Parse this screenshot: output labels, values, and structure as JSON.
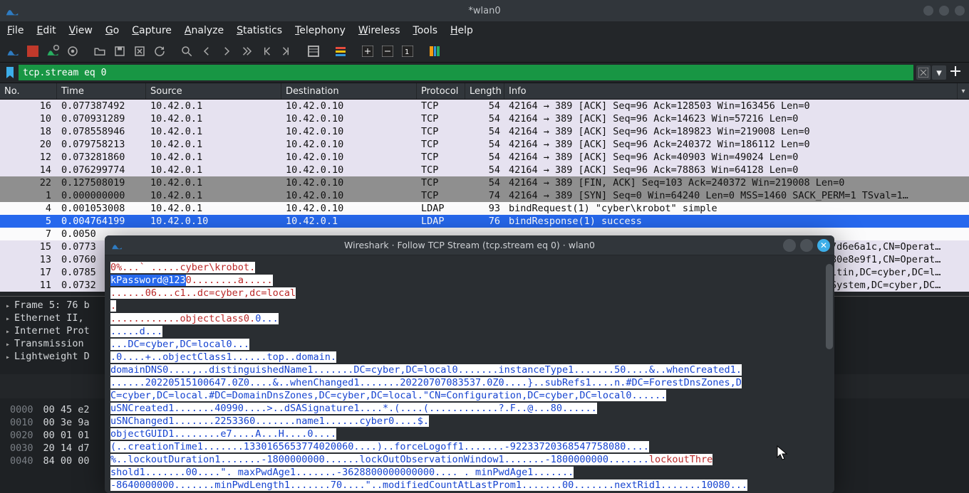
{
  "titlebar": {
    "title": "*wlan0"
  },
  "menubar": [
    "File",
    "Edit",
    "View",
    "Go",
    "Capture",
    "Analyze",
    "Statistics",
    "Telephony",
    "Wireless",
    "Tools",
    "Help"
  ],
  "filter": {
    "value": "tcp.stream eq 0"
  },
  "columns": [
    "No.",
    "Time",
    "Source",
    "Destination",
    "Protocol",
    "Length",
    "Info"
  ],
  "packets": [
    {
      "no": "16",
      "time": "0.077387492",
      "src": "10.42.0.1",
      "dst": "10.42.0.10",
      "proto": "TCP",
      "len": "54",
      "info": "42164 → 389 [ACK] Seq=96 Ack=128503 Win=163456 Len=0",
      "cls": ""
    },
    {
      "no": "10",
      "time": "0.070931289",
      "src": "10.42.0.1",
      "dst": "10.42.0.10",
      "proto": "TCP",
      "len": "54",
      "info": "42164 → 389 [ACK] Seq=96 Ack=14623 Win=57216 Len=0",
      "cls": ""
    },
    {
      "no": "18",
      "time": "0.078558946",
      "src": "10.42.0.1",
      "dst": "10.42.0.10",
      "proto": "TCP",
      "len": "54",
      "info": "42164 → 389 [ACK] Seq=96 Ack=189823 Win=219008 Len=0",
      "cls": ""
    },
    {
      "no": "20",
      "time": "0.079758213",
      "src": "10.42.0.1",
      "dst": "10.42.0.10",
      "proto": "TCP",
      "len": "54",
      "info": "42164 → 389 [ACK] Seq=96 Ack=240372 Win=186112 Len=0",
      "cls": ""
    },
    {
      "no": "12",
      "time": "0.073281860",
      "src": "10.42.0.1",
      "dst": "10.42.0.10",
      "proto": "TCP",
      "len": "54",
      "info": "42164 → 389 [ACK] Seq=96 Ack=40903 Win=49024 Len=0",
      "cls": ""
    },
    {
      "no": "14",
      "time": "0.076299774",
      "src": "10.42.0.1",
      "dst": "10.42.0.10",
      "proto": "TCP",
      "len": "54",
      "info": "42164 → 389 [ACK] Seq=96 Ack=78863 Win=64128 Len=0",
      "cls": ""
    },
    {
      "no": "22",
      "time": "0.127508019",
      "src": "10.42.0.1",
      "dst": "10.42.0.10",
      "proto": "TCP",
      "len": "54",
      "info": "42164 → 389 [FIN, ACK] Seq=103 Ack=240372 Win=219008 Len=0",
      "cls": "gray"
    },
    {
      "no": "1",
      "time": "0.000000000",
      "src": "10.42.0.1",
      "dst": "10.42.0.10",
      "proto": "TCP",
      "len": "74",
      "info": "42164 → 389 [SYN] Seq=0 Win=64240 Len=0 MSS=1460 SACK_PERM=1 TSval=1…",
      "cls": "gray"
    },
    {
      "no": "4",
      "time": "0.001053008",
      "src": "10.42.0.1",
      "dst": "10.42.0.10",
      "proto": "LDAP",
      "len": "93",
      "info": "bindRequest(1) \"cyber\\krobot\" simple",
      "cls": "white"
    },
    {
      "no": "5",
      "time": "0.004764199",
      "src": "10.42.0.10",
      "dst": "10.42.0.1",
      "proto": "LDAP",
      "len": "76",
      "info": "bindResponse(1) success",
      "cls": "sel"
    },
    {
      "no": "7",
      "time": "0.0050",
      "src": "",
      "dst": "",
      "proto": "",
      "len": "",
      "info": "",
      "cls": "white"
    },
    {
      "no": "15",
      "time": "0.0773",
      "src": "",
      "dst": "",
      "proto": "",
      "len": "",
      "info": "7d6e6a1c,CN=Operat…",
      "cls": ""
    },
    {
      "no": "13",
      "time": "0.0760",
      "src": "",
      "dst": "",
      "proto": "",
      "len": "",
      "info": "80e8e9f1,CN=Operat…",
      "cls": ""
    },
    {
      "no": "17",
      "time": "0.0785",
      "src": "",
      "dst": "",
      "proto": "",
      "len": "",
      "info": "ltin,DC=cyber,DC=l…",
      "cls": ""
    },
    {
      "no": "11",
      "time": "0.0732",
      "src": "",
      "dst": "",
      "proto": "",
      "len": "",
      "info": "System,DC=cyber,DC…",
      "cls": ""
    }
  ],
  "tree": [
    "Frame 5: 76 b",
    "Ethernet II,",
    "Internet Prot",
    "Transmission",
    "Lightweight D"
  ],
  "hex": [
    {
      "off": "0000",
      "bytes": "00 45 e2"
    },
    {
      "off": "0010",
      "bytes": "00 3e 9a"
    },
    {
      "off": "0020",
      "bytes": "00 01 01"
    },
    {
      "off": "0030",
      "bytes": "20 14 d7"
    },
    {
      "off": "0040",
      "bytes": "84 00 00"
    }
  ],
  "dialog": {
    "title": "Wireshark · Follow TCP Stream (tcp.stream eq 0) · wlan0",
    "lines": [
      [
        {
          "t": "0%...` .....cyber\\krobot.",
          "c": "req"
        }
      ],
      [
        {
          "t": "kPassword@123",
          "c": "reqhl"
        },
        {
          "t": "0........a.....",
          "c": "req"
        }
      ],
      [
        {
          "t": "......06...c1..dc=cyber,dc=local",
          "c": "req"
        }
      ],
      [
        {
          "t": ".",
          "c": "req"
        }
      ],
      [
        {
          "t": "............objectclass0.",
          "c": "req"
        },
        {
          "t": "0...",
          "c": "res"
        }
      ],
      [
        {
          "t": ".....d...",
          "c": "res"
        }
      ],
      [
        {
          "t": "...DC=cyber,DC=local0...",
          "c": "res"
        }
      ],
      [
        {
          "t": ".0....+..objectClass1......top..domain.",
          "c": "res"
        }
      ],
      [
        {
          "t": "domainDNS0....,..distinguishedName1.......DC=cyber,DC=local0.......instanceType1.......50....&..whenCreated1.",
          "c": "res"
        }
      ],
      [
        {
          "t": "......20220515100647.0Z0....&..whenChanged1.......20220707083537.0Z0....}..subRefs1....n.#DC=ForestDnsZones,D",
          "c": "res"
        }
      ],
      [
        {
          "t": "C=cyber,DC=local.#DC=DomainDnsZones,DC=cyber,DC=local.\"CN=Configuration,DC=cyber,DC=local0......",
          "c": "res"
        }
      ],
      [
        {
          "t": "uSNCreated1.......40990....>..dSASignature1....*.(....(............?.F..@...80......",
          "c": "res"
        }
      ],
      [
        {
          "t": "uSNChanged1.......2253360.......name1......cyber0....$.",
          "c": "res"
        }
      ],
      [
        {
          "t": "objectGUID1........e7....A...H....0....",
          "c": "res"
        }
      ],
      [
        {
          "t": "(..creationTime1.......1330165653774020060....)..forceLogoff1.......-92233720368547758080....",
          "c": "res"
        }
      ],
      [
        {
          "t": "%..lockoutDuration1.......-1800000000......lockOutObservationWindow1.......-1800000000.......",
          "c": "res"
        },
        {
          "t": "lockoutThre",
          "c": "req"
        }
      ],
      [
        {
          "t": "shold1.......00....\".     maxPwdAge1.......-3628800000000000.... .      minPwdAge1.......",
          "c": "res"
        }
      ],
      [
        {
          "t": "-8640000000.......minPwdLength1.......70....\"..modifiedCountAtLastProm1.......00.......nextRid1.......10080...",
          "c": "res"
        }
      ]
    ]
  }
}
